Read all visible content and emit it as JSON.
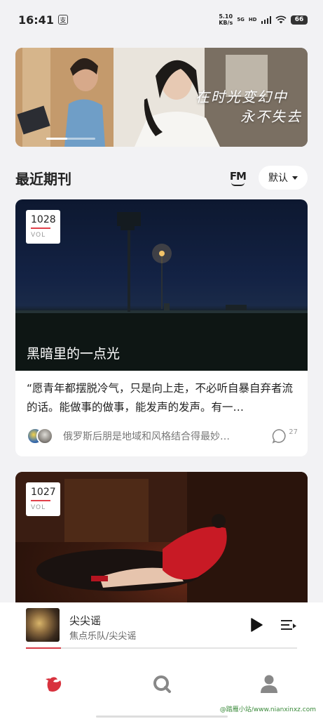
{
  "status_bar": {
    "time": "16:41",
    "app_icon_glyph": "支",
    "net_speed_value": "5.10",
    "net_speed_unit": "KB/s",
    "net_type_1": "5G",
    "net_type_2": "HD",
    "battery": "66"
  },
  "banner": {
    "text_line1": "在时光变幻中",
    "text_line2": "永不失去"
  },
  "section": {
    "title": "最近期刊",
    "fm_label": "FM",
    "sort_label": "默认"
  },
  "volumes": [
    {
      "vol_number": "1028",
      "vol_label": "VOL",
      "title": "黑暗里的一点光",
      "excerpt": "“愿青年都摆脱冷气，只是向上走，不必听自暴自弃者流的话。能做事的做事，能发声的发声。有一…",
      "comment_preview": "俄罗斯后朋是地域和风格结合得最妙…",
      "comment_count": "27"
    },
    {
      "vol_number": "1027",
      "vol_label": "VOL"
    }
  ],
  "player": {
    "title": "尖尖谣",
    "artist": "焦点乐队/尖尖谣",
    "progress": 0.13
  },
  "tabs": [
    "home-icon",
    "search-icon",
    "profile-icon"
  ],
  "watermark": "@踏雁小站/www.nianxinxz.com",
  "colors": {
    "accent": "#d83a45",
    "background": "#f2f2f4"
  }
}
